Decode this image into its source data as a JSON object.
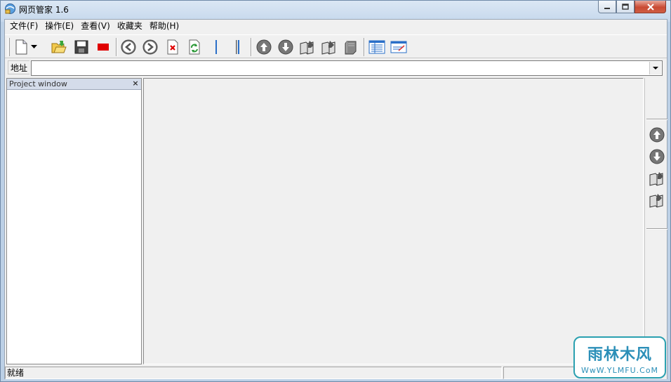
{
  "window": {
    "title": "网页管家 1.6"
  },
  "menu": [
    {
      "label": "文件(F)"
    },
    {
      "label": "操作(E)"
    },
    {
      "label": "查看(V)"
    },
    {
      "label": "收藏夹"
    },
    {
      "label": "帮助(H)"
    }
  ],
  "toolbar": {
    "icons": [
      "new-file-icon",
      "dropdown-arrow-icon",
      "open-folder-icon",
      "save-icon",
      "stop-icon",
      "back-icon",
      "forward-icon",
      "delete-icon",
      "refresh-icon",
      "split-vertical-icon",
      "split-double-icon",
      "move-up-icon",
      "move-down-icon",
      "edit-book-icon",
      "edit-book-2-icon",
      "book-icon",
      "list-view-icon",
      "web-view-icon"
    ]
  },
  "address": {
    "label": "地址",
    "value": ""
  },
  "project": {
    "title": "Project window",
    "close": "×"
  },
  "status": {
    "text": "就绪"
  },
  "watermark": {
    "main": "雨林木风",
    "sub": "WwW.YLMFU.CoM"
  },
  "colors": {
    "accent_blue": "#2a6fc8",
    "stop_red": "#e00000",
    "refresh_green": "#2e9a3a"
  }
}
